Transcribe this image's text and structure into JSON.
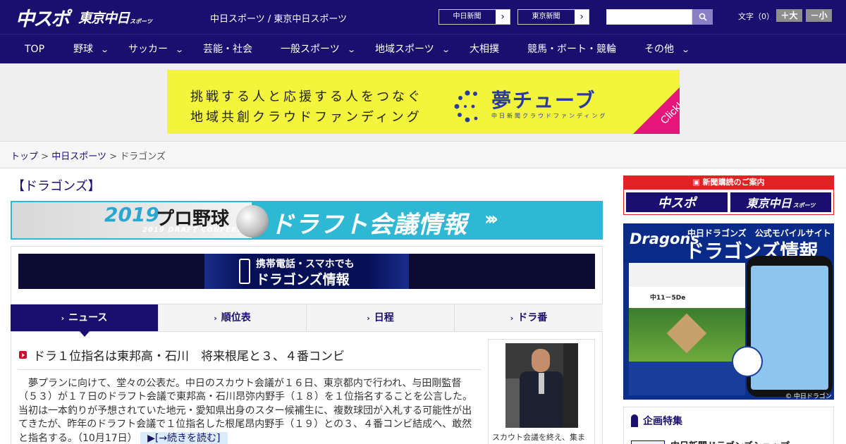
{
  "header": {
    "logo_main": "中スポ",
    "logo_sub": "東京中日",
    "logo_sub_small": "スポーツ",
    "site_links": "中日スポーツ / 東京中日スポーツ",
    "paper_buttons": [
      "中日新聞",
      "東京新聞"
    ],
    "search": {
      "placeholder": "",
      "button_icon": "search-icon"
    },
    "font_size_label": "文字（0）",
    "font_plus": "＋大",
    "font_minus": "－小"
  },
  "nav": {
    "items": [
      {
        "label": "TOP",
        "has_menu": false
      },
      {
        "label": "野球",
        "has_menu": true
      },
      {
        "label": "サッカー",
        "has_menu": true
      },
      {
        "label": "芸能・社会",
        "has_menu": false
      },
      {
        "label": "一般スポーツ",
        "has_menu": true
      },
      {
        "label": "地域スポーツ",
        "has_menu": true
      },
      {
        "label": "大相撲",
        "has_menu": false
      },
      {
        "label": "競馬・ボート・競輪",
        "has_menu": false
      },
      {
        "label": "その他",
        "has_menu": true
      }
    ]
  },
  "ad_banner": {
    "line1": "挑戦する人と応援する人をつなぐ",
    "line2": "地域共創クラウドファンディング",
    "brand": "夢チューブ",
    "brand_sub": "中日新聞クラウドファンディング",
    "click": "Click!",
    "colors": {
      "background": "#f3f43c",
      "brand": "#2a3ba0",
      "click_corner": "#e5157a"
    }
  },
  "breadcrumb": {
    "home": "トップ",
    "sep": ">",
    "parent": "中日スポーツ",
    "current": "ドラゴンズ"
  },
  "section_title": "【ドラゴンズ】",
  "draft_banner": {
    "year": "2019",
    "pro": "プロ野球",
    "eng": "2019 DRAFT CONFERENCE",
    "main": "ドラフト会議情報",
    "arrows": "»",
    "colors": {
      "background": "#2fb8d3"
    }
  },
  "mobile_banner": {
    "line1": "携帯電話・スマホでも",
    "line2": "ドラゴンズ情報"
  },
  "tabs": [
    {
      "label": "ニュース",
      "active": true
    },
    {
      "label": "順位表",
      "active": false
    },
    {
      "label": "日程",
      "active": false
    },
    {
      "label": "ドラ番",
      "active": false
    }
  ],
  "article": {
    "headline": "ドラ１位指名は東邦高・石川　将来根尾と３、４番コンビ",
    "body": "　夢プランに向けて、堂々の公表だ。中日のスカウト会議が１６日、東京都内で行われ、与田剛監督（５３）が１７日のドラフト会議で東邦高・石川昂弥内野手（１８）を１位指名することを公言した。当初は一本釣りが予想されていた地元・愛知県出身のスター候補生に、複数球団が入札する可能性が出てきたが、昨年のドラフト会議で１位指名した根尾昂内野手（１９）との３、４番コンビ結成へ、敢然と指名する。",
    "date": "（10月17日）",
    "more": "▶[→続きを読む]",
    "photo_caption": "スカウト会議を終え、集ま"
  },
  "sidebar": {
    "subscribe": {
      "title": "新聞購読のご案内",
      "btn1": "中スポ",
      "btn2": "東京中日",
      "btn2_small": "スポーツ"
    },
    "dragons_ad": {
      "logo": "Dragons",
      "sub1": "中日ドラゴンズ　公式モバイルサイト",
      "title": "ドラゴンズ情報",
      "score": "中11－5De",
      "footer": "© 中日ドラゴンズ"
    },
    "kikaku": {
      "title": "企画特集",
      "item1": "中日新聞ドラゴンズショップ"
    }
  }
}
